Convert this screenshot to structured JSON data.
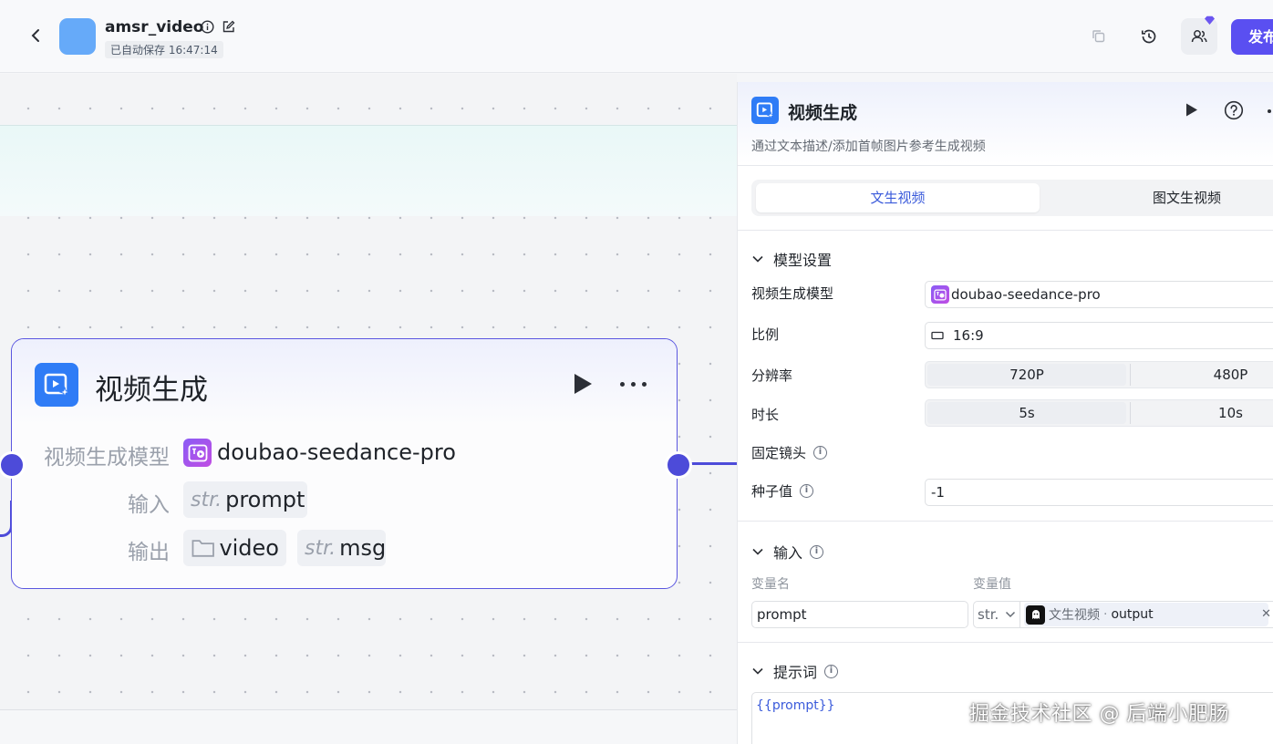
{
  "header": {
    "title": "amsr_video",
    "autosave": "已自动保存 16:47:14",
    "publish_label": "发布",
    "colors": {
      "app_icon": "#66aaf9",
      "publish": "#5a4ff1"
    }
  },
  "canvas": {
    "node": {
      "title": "视频生成",
      "model_label": "视频生成模型",
      "model_name": "doubao-seedance-pro",
      "input_label": "输入",
      "input_type": "str.",
      "input_name": "prompt",
      "output_label": "输出",
      "output_video": "video",
      "output_type": "str.",
      "output_msg": "msg",
      "accent": "#4d4bd9"
    }
  },
  "panel": {
    "title": "视频生成",
    "description": "通过文本描述/添加首帧图片参考生成视频",
    "tabs": [
      {
        "label": "文生视频",
        "active": true
      },
      {
        "label": "图文生视频",
        "active": false
      }
    ],
    "model_section": {
      "title": "模型设置",
      "model_label": "视频生成模型",
      "model_value": "doubao-seedance-pro",
      "ratio_label": "比例",
      "ratio_value": "16:9",
      "resolution_label": "分辨率",
      "resolution_options": [
        "720P",
        "480P"
      ],
      "resolution_selected": "720P",
      "duration_label": "时长",
      "duration_options": [
        "5s",
        "10s"
      ],
      "duration_selected": "5s",
      "fixed_camera_label": "固定镜头",
      "seed_label": "种子值",
      "seed_value": "-1"
    },
    "input_section": {
      "title": "输入",
      "col_name": "变量名",
      "col_value": "变量值",
      "var_name": "prompt",
      "var_type": "str.",
      "ref_node": "文生视频",
      "ref_sep": "·",
      "ref_output": "output"
    },
    "prompt_section": {
      "title": "提示词",
      "content": "{{prompt}}"
    }
  },
  "watermark": "掘金技术社区 @ 后端小肥肠"
}
